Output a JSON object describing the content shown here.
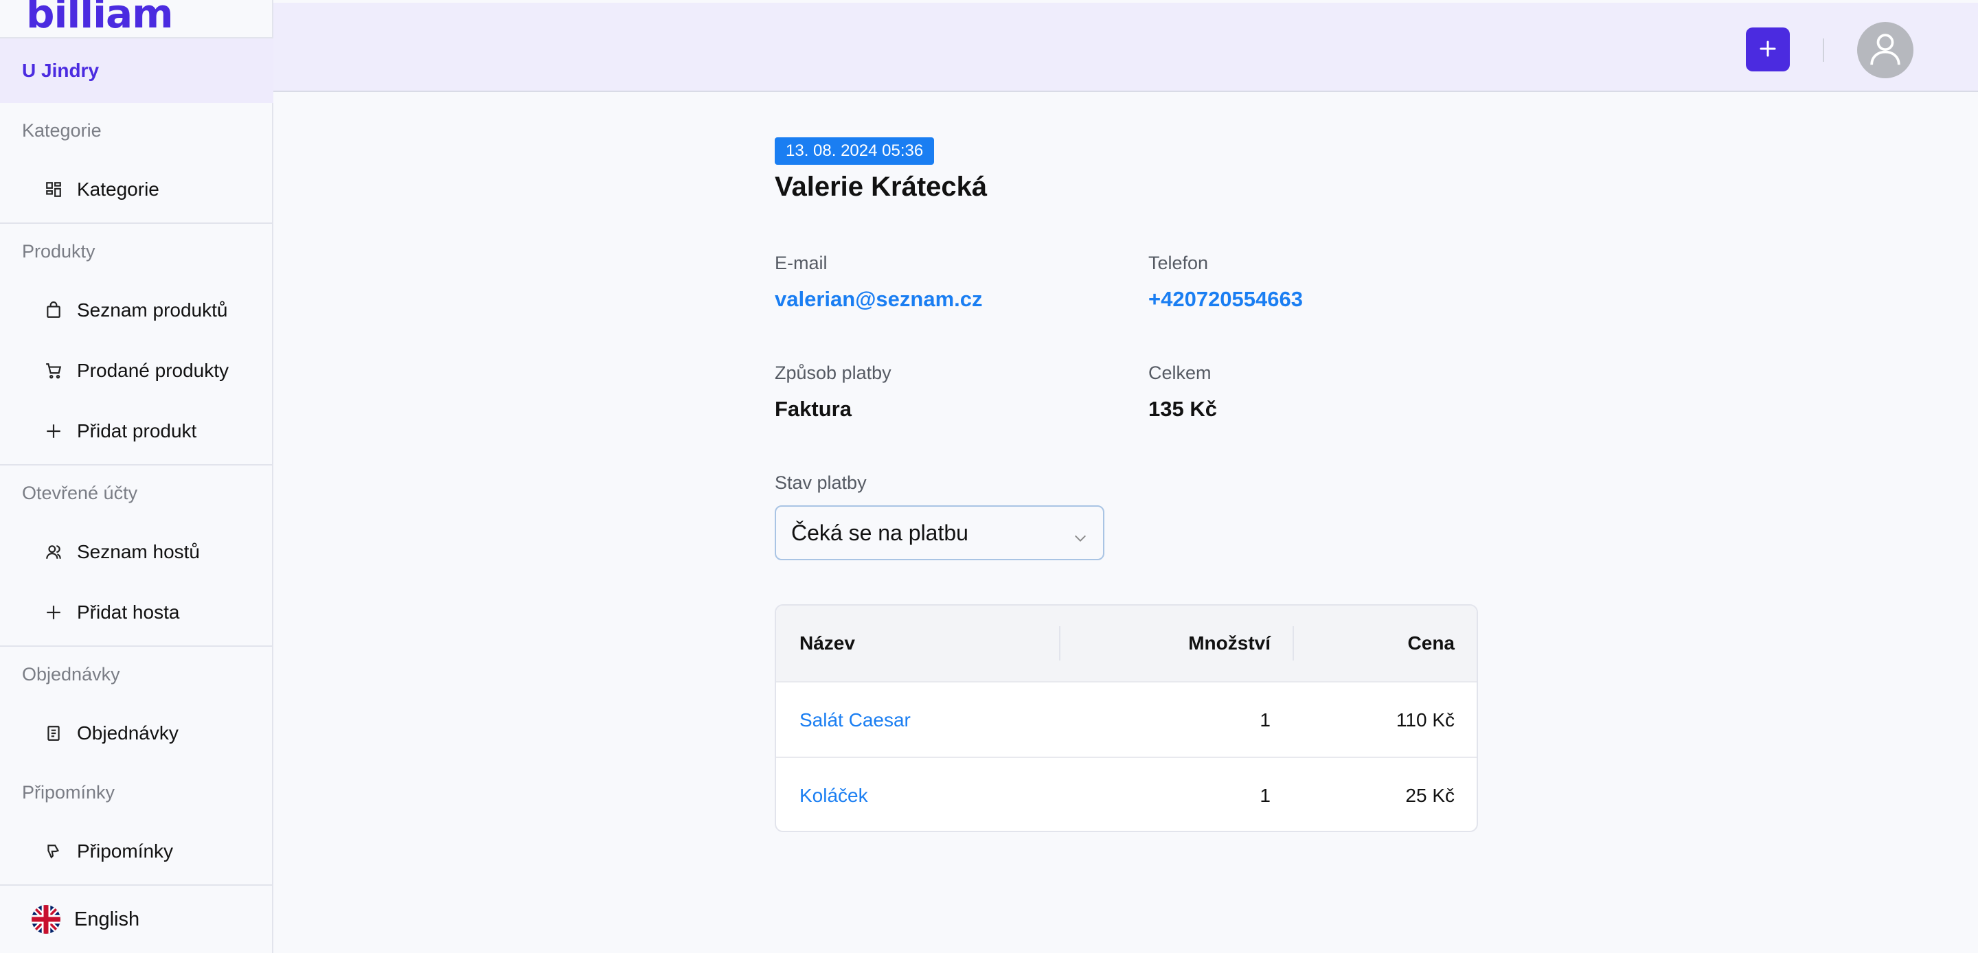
{
  "brand": {
    "logo": "billiam"
  },
  "sidebar": {
    "venue": "U Jindry",
    "sections": [
      {
        "title": "Kategorie",
        "items": [
          {
            "label": "Kategorie",
            "icon": "grid-icon"
          }
        ]
      },
      {
        "title": "Produkty",
        "items": [
          {
            "label": "Seznam produktů",
            "icon": "bag-icon"
          },
          {
            "label": "Prodané produkty",
            "icon": "cart-icon"
          },
          {
            "label": "Přidat produkt",
            "icon": "plus-icon"
          }
        ]
      },
      {
        "title": "Otevřené účty",
        "items": [
          {
            "label": "Seznam hostů",
            "icon": "users-icon"
          },
          {
            "label": "Přidat hosta",
            "icon": "plus-icon"
          }
        ]
      },
      {
        "title": "Objednávky",
        "items": [
          {
            "label": "Objednávky",
            "icon": "receipt-icon"
          }
        ]
      },
      {
        "title": "Připomínky",
        "items": [
          {
            "label": "Připomínky",
            "icon": "thumbs-down-icon"
          }
        ]
      }
    ],
    "language": {
      "label": "English",
      "icon": "uk-flag-icon"
    }
  },
  "header": {
    "add_icon": "plus-icon",
    "avatar_icon": "user-avatar-icon"
  },
  "order": {
    "date": "13. 08. 2024 05:36",
    "guest_name": "Valerie Krátecká",
    "email_label": "E-mail",
    "email": "valerian@seznam.cz",
    "phone_label": "Telefon",
    "phone": "+420720554663",
    "payment_method_label": "Způsob platby",
    "payment_method": "Faktura",
    "total_label": "Celkem",
    "total": "135 Kč",
    "payment_status_label": "Stav platby",
    "payment_status": "Čeká se na platbu"
  },
  "table": {
    "columns": [
      "Název",
      "Množství",
      "Cena"
    ],
    "rows": [
      {
        "name": "Salát Caesar",
        "qty": "1",
        "price": "110 Kč"
      },
      {
        "name": "Koláček",
        "qty": "1",
        "price": "25 Kč"
      }
    ]
  },
  "colors": {
    "brand": "#4b2be0",
    "link": "#1a7ef2",
    "header_bg": "#efedfc"
  }
}
